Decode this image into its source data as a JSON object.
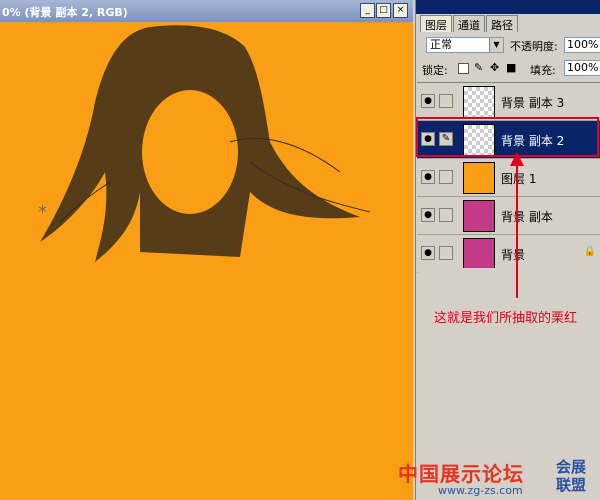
{
  "document": {
    "title": "0% (背景 副本 2, RGB)",
    "buttons": {
      "minimize": "_",
      "maximize": "□",
      "close": "×"
    },
    "canvas_color": "#fa9f15"
  },
  "layers_palette": {
    "tabs": [
      {
        "label": "图层"
      },
      {
        "label": "通道"
      },
      {
        "label": "路径"
      }
    ],
    "blend_mode": "正常",
    "opacity_label": "不透明度:",
    "opacity_value": "100%",
    "lock_label": "锁定:",
    "fill_label": "填充:",
    "fill_value": "100%",
    "layers": [
      {
        "name": "背景 副本 3",
        "thumb": "transparent-figure",
        "selected": false
      },
      {
        "name": "背景 副本 2",
        "thumb": "transparent-figure",
        "selected": true
      },
      {
        "name": "图层 1",
        "thumb": "solid-orange",
        "selected": false
      },
      {
        "name": "背景 副本",
        "thumb": "photo",
        "selected": false
      },
      {
        "name": "背景",
        "thumb": "photo",
        "selected": false
      }
    ]
  },
  "annotation": {
    "text": "这就是我们所抽取的栗红",
    "color": "#e0001b"
  },
  "watermark": {
    "main": "中国展示论坛",
    "url": "www.zg-zs.com",
    "side": "会展联盟"
  }
}
